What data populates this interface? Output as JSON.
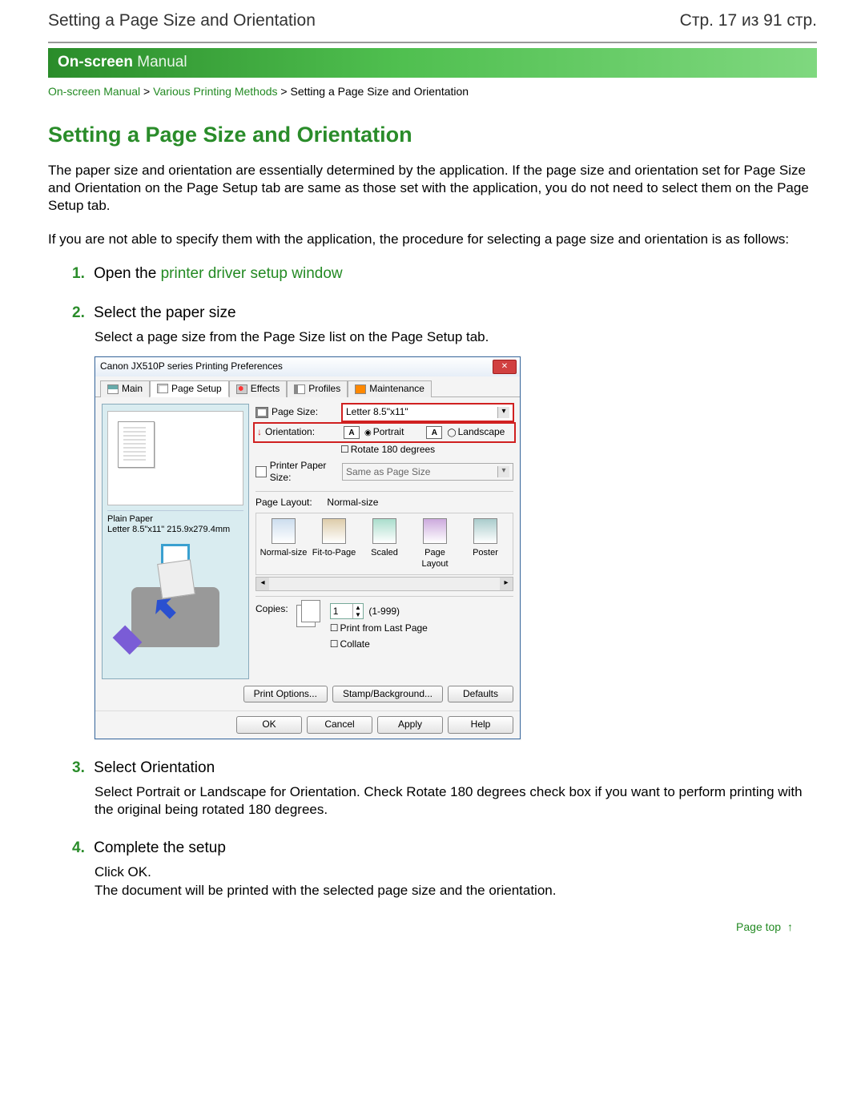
{
  "header": {
    "left": "Setting a Page Size and Orientation",
    "right": "Стр. 17 из 91 стр."
  },
  "banner": {
    "bold": "On-screen",
    "thin": " Manual"
  },
  "breadcrumb": {
    "a": "On-screen Manual",
    "sep1": " > ",
    "b": "Various Printing Methods",
    "sep2": " > ",
    "c": "Setting a Page Size and Orientation"
  },
  "title": "Setting a Page Size and Orientation",
  "para1": "The paper size and orientation are essentially determined by the application. If the page size and orientation set for Page Size and Orientation on the Page Setup tab are same as those set with the application, you do not need to select them on the Page Setup tab.",
  "para2": "If you are not able to specify them with the application, the procedure for selecting a page size and orientation is as follows:",
  "steps": {
    "s1_num": "1.",
    "s1_pre": "Open the ",
    "s1_link": "printer driver setup window",
    "s2_num": "2.",
    "s2_head": "Select the paper size",
    "s2_body": "Select a page size from the Page Size list on the Page Setup tab.",
    "s3_num": "3.",
    "s3_head": "Select Orientation",
    "s3_body": "Select Portrait or Landscape for Orientation. Check Rotate 180 degrees check box if you want to perform printing with the original being rotated 180 degrees.",
    "s4_num": "4.",
    "s4_head": "Complete the setup",
    "s4_body1": "Click OK.",
    "s4_body2": "The document will be printed with the selected page size and the orientation."
  },
  "dialog": {
    "title": "Canon JX510P series Printing Preferences",
    "tabs": {
      "main": "Main",
      "page": "Page Setup",
      "eff": "Effects",
      "prof": "Profiles",
      "mnt": "Maintenance"
    },
    "preview_info1": "Plain Paper",
    "preview_info2": "Letter 8.5\"x11\" 215.9x279.4mm",
    "page_size_label": "Page Size:",
    "page_size_value": "Letter 8.5\"x11\"",
    "orientation_label": "Orientation:",
    "portrait": "Portrait",
    "landscape": "Landscape",
    "rotate": "Rotate 180 degrees",
    "printer_paper_label": "Printer Paper Size:",
    "printer_paper_value": "Same as Page Size",
    "page_layout_lead": "Page Layout:",
    "page_layout_value": "Normal-size",
    "layouts": {
      "a": "Normal-size",
      "b": "Fit-to-Page",
      "c": "Scaled",
      "d": "Page Layout",
      "e": "Poster"
    },
    "copies_label": "Copies:",
    "copies_value": "1",
    "copies_range": "(1-999)",
    "print_last": "Print from Last Page",
    "collate": "Collate",
    "print_options": "Print Options...",
    "stamp": "Stamp/Background...",
    "defaults": "Defaults",
    "ok": "OK",
    "cancel": "Cancel",
    "apply": "Apply",
    "help": "Help"
  },
  "pagetop": "Page top"
}
